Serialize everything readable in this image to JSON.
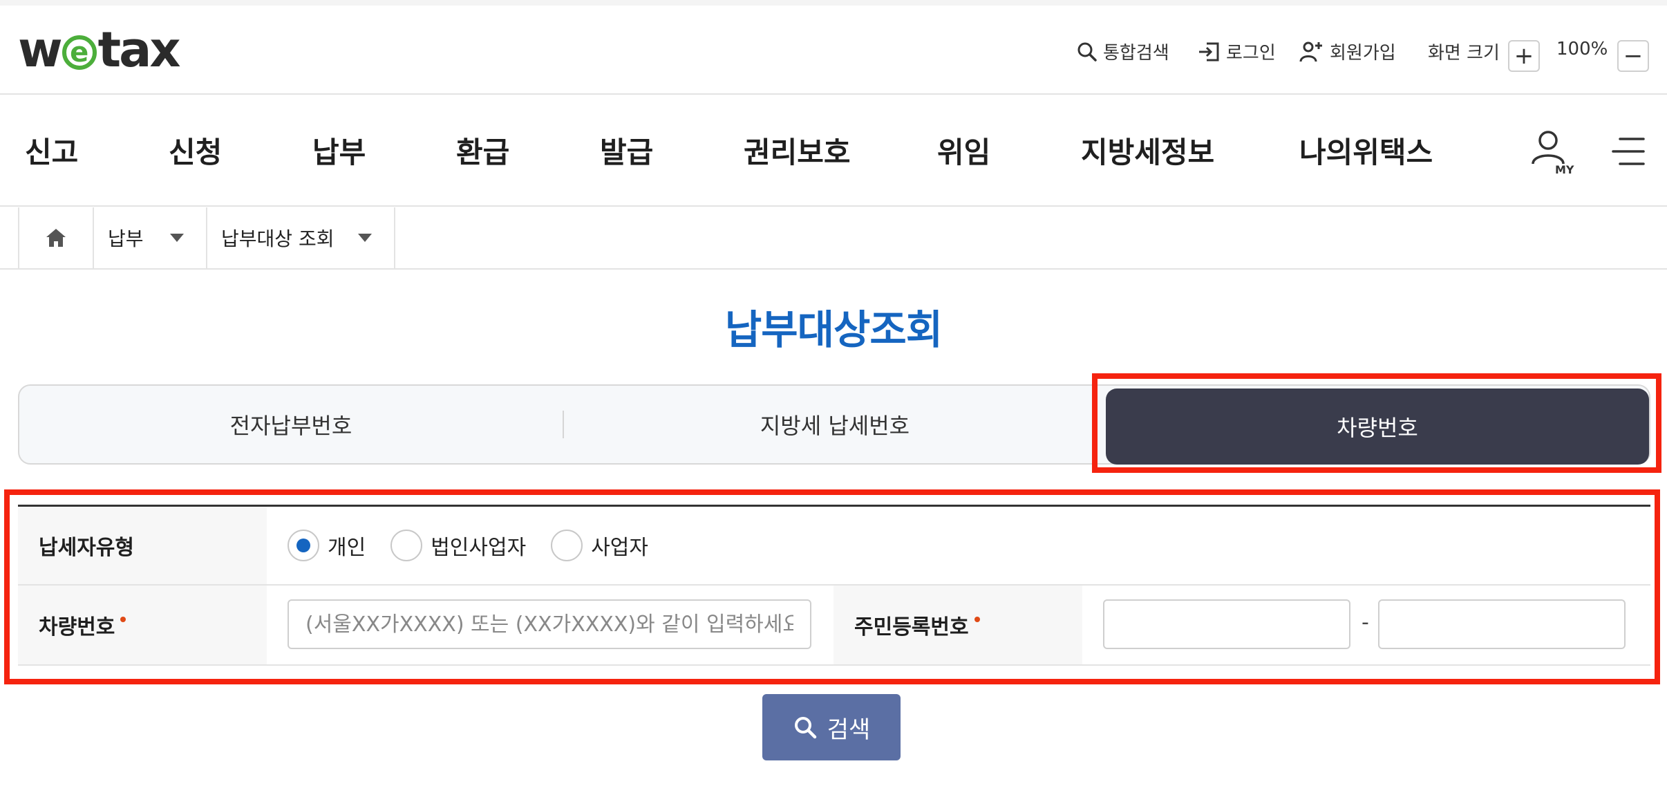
{
  "logo": {
    "text_pre": "w",
    "text_e": "e",
    "text_post": "tax"
  },
  "util": {
    "search_label": "통합검색",
    "login_label": "로그인",
    "signup_label": "회원가입",
    "zoom_label": "화면 크기",
    "zoom_in": "+",
    "zoom_value": "100%",
    "zoom_out": "−"
  },
  "gnb": [
    "신고",
    "신청",
    "납부",
    "환급",
    "발급",
    "권리보호",
    "위임",
    "지방세정보",
    "나의위택스"
  ],
  "my_icon_label": "MY",
  "breadcrumb": {
    "level1": "납부",
    "level2": "납부대상 조회"
  },
  "page_title": "납부대상조회",
  "tabs": [
    "전자납부번호",
    "지방세 납세번호",
    "차량번호"
  ],
  "active_tab_index": 2,
  "form": {
    "taxpayer_type_label": "납세자유형",
    "taxpayer_types": [
      "개인",
      "법인사업자",
      "사업자"
    ],
    "selected_taxpayer_type": "개인",
    "vehicle_label": "차량번호",
    "vehicle_placeholder": "(서울XX가XXXX) 또는 (XX가XXXX)와 같이 입력하세요.",
    "rrn_label": "주민등록번호",
    "rrn_dash": "-"
  },
  "search_button": "검색",
  "colors": {
    "accent_blue": "#1565c0",
    "active_tab": "#3a3c4c",
    "search_button": "#5b6fa4",
    "highlight": "#f5230f",
    "logo_green": "#4cae3b"
  }
}
